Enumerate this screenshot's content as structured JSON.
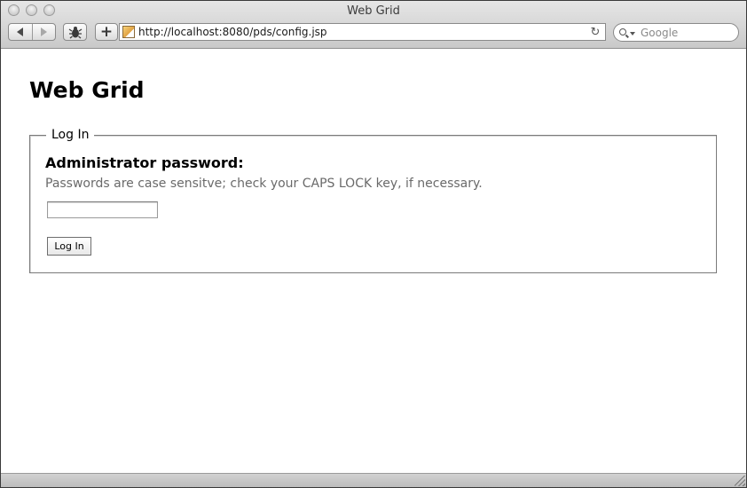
{
  "window": {
    "title": "Web Grid"
  },
  "toolbar": {
    "back_icon": "back-arrow-icon",
    "forward_icon": "forward-arrow-icon",
    "debug_icon": "bug-icon",
    "add_bookmark_label": "+",
    "url": "http://localhost:8080/pds/config.jsp",
    "reload_glyph": "↻",
    "search_placeholder": "Google"
  },
  "page": {
    "title": "Web Grid",
    "login": {
      "legend": "Log In",
      "password_label": "Administrator password:",
      "password_hint": "Passwords are case sensitve; check your CAPS LOCK key, if necessary.",
      "password_value": "",
      "submit_label": "Log In"
    }
  },
  "colors": {
    "hint_text": "#6a6a6a",
    "fieldset_border": "#7a7a7a",
    "chrome_top": "#e6e6e6",
    "chrome_bottom": "#c9c9c9"
  }
}
